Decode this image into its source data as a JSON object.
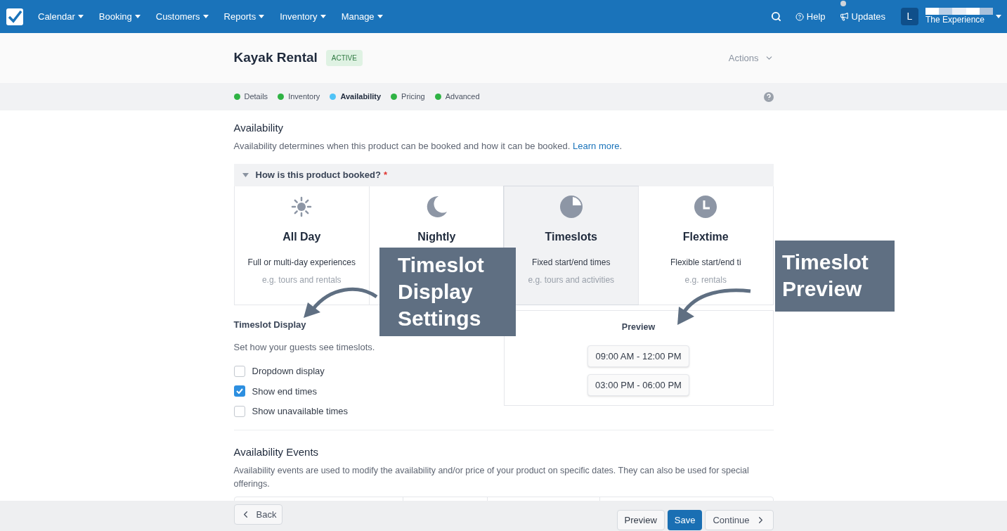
{
  "nav": {
    "items": [
      {
        "label": "Calendar"
      },
      {
        "label": "Booking"
      },
      {
        "label": "Customers"
      },
      {
        "label": "Reports"
      },
      {
        "label": "Inventory"
      },
      {
        "label": "Manage"
      }
    ],
    "help": "Help",
    "updates": "Updates",
    "user": {
      "initial": "L",
      "org": "The Experience"
    }
  },
  "product": {
    "title": "Kayak Rental",
    "status": "ACTIVE",
    "actions": "Actions"
  },
  "steps": [
    {
      "label": "Details",
      "selected": false,
      "color": "#2fb344"
    },
    {
      "label": "Inventory",
      "selected": false,
      "color": "#2fb344"
    },
    {
      "label": "Availability",
      "selected": true,
      "color": "#4fc3f7"
    },
    {
      "label": "Pricing",
      "selected": false,
      "color": "#2fb344"
    },
    {
      "label": "Advanced",
      "selected": false,
      "color": "#2fb344"
    }
  ],
  "availability": {
    "heading": "Availability",
    "description": "Availability determines when this product can be booked and how it can be booked.",
    "link": "Learn more",
    "after": "."
  },
  "booking": {
    "question": "How is this product booked?",
    "required": "*",
    "expanded": true,
    "options": [
      {
        "kind": "sun",
        "title": "All Day",
        "description": "Full or multi-day experiences",
        "example": "e.g. tours and rentals",
        "selected": false
      },
      {
        "kind": "moon",
        "title": "Nightly",
        "selected": false
      },
      {
        "kind": "pie",
        "title": "Timeslots",
        "description": "Fixed start/end times",
        "example": "e.g. tours and activities",
        "selected": true
      },
      {
        "kind": "clock",
        "title": "Flextime",
        "description": "Flexible start/end ti",
        "example": "e.g. rentals",
        "selected": false
      }
    ]
  },
  "display": {
    "title": "Timeslot Display",
    "description": "Set how your guests see timeslots.",
    "options": [
      {
        "label": "Dropdown display",
        "checked": false
      },
      {
        "label": "Show end times",
        "checked": true
      },
      {
        "label": "Show unavailable times",
        "checked": false
      }
    ]
  },
  "preview": {
    "title": "Preview",
    "slots": [
      "09:00 AM - 12:00 PM",
      "03:00 PM - 06:00 PM"
    ]
  },
  "events": {
    "heading": "Availability Events",
    "description": "Availability events are used to modify the availability and/or price of your product on specific dates. They can also be used for special offerings."
  },
  "footer": {
    "back": "Back",
    "preview": "Preview",
    "save": "Save",
    "continue": "Continue"
  },
  "callouts": [
    {
      "text": "Timeslot Display Settings"
    },
    {
      "text": "Timeslot Preview"
    }
  ]
}
